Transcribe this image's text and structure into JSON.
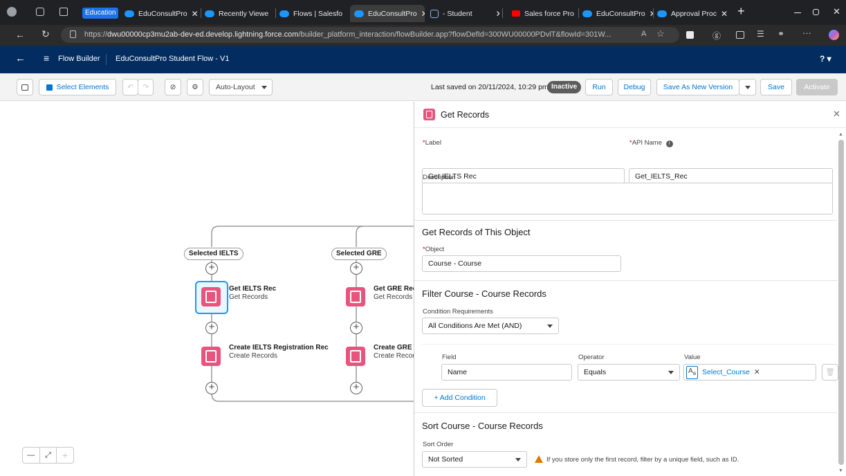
{
  "browser": {
    "tab_group_label": "Education",
    "tabs": [
      {
        "label": "EduConsultPro",
        "icon": "salesforce-icon",
        "active": false
      },
      {
        "label": "Recently Viewe",
        "icon": "salesforce-icon",
        "active": false
      },
      {
        "label": "Flows | Salesfo",
        "icon": "salesforce-icon",
        "active": false
      },
      {
        "label": "EduConsultPro",
        "icon": "salesforce-icon",
        "active": true
      },
      {
        "label": "- Student",
        "icon": "page-icon",
        "active": false
      },
      {
        "label": "Sales force Pro",
        "icon": "youtube-icon",
        "active": false
      },
      {
        "label": "EduConsultPro",
        "icon": "salesforce-icon",
        "active": false
      },
      {
        "label": "Approval Proc",
        "icon": "salesforce-icon",
        "active": false
      }
    ],
    "new_tab": "+",
    "url_prefix": "https://",
    "url_host": "dwu00000cp3mu2ab-dev-ed.develop.lightning.force.com",
    "url_path": "/builder_platform_interaction/flowBuilder.app?flowDefId=300WU00000PDvlT&flowId=301W..."
  },
  "header": {
    "app_name": "Flow Builder",
    "flow_title": "EduConsultPro Student Flow - V1",
    "help": "?"
  },
  "toolbar": {
    "select_elements": "Select Elements",
    "auto_layout": "Auto-Layout",
    "last_saved": "Last saved on 20/11/2024, 10:29 pm",
    "status_badge": "Inactive",
    "run": "Run",
    "debug": "Debug",
    "save_as_new_version": "Save As New Version",
    "save": "Save",
    "activate": "Activate"
  },
  "canvas": {
    "branches": [
      {
        "label": "Selected IELTS",
        "get_title": "Get IELTS Rec",
        "get_type": "Get Records",
        "create_title": "Create IELTS Registration Rec",
        "create_type": "Create Records"
      },
      {
        "label": "Selected GRE",
        "get_title": "Get GRE Rec",
        "get_type": "Get Records",
        "create_title": "Create GRE I",
        "create_type": "Create Recor"
      }
    ],
    "zoom_out": "—",
    "zoom_fit": "⤢",
    "zoom_in": "+"
  },
  "panel": {
    "title": "Get Records",
    "label_label": "Label",
    "label_value": "Get IELTS Rec",
    "api_name_label": "API Name",
    "api_name_value": "Get_IELTS_Rec",
    "description_label": "Description",
    "description_value": "",
    "object_section": "Get Records of This Object",
    "object_label": "Object",
    "object_value": "Course - Course",
    "filter_section": "Filter Course - Course Records",
    "condition_req_label": "Condition Requirements",
    "condition_req_value": "All Conditions Are Met (AND)",
    "col_field": "Field",
    "col_operator": "Operator",
    "col_value": "Value",
    "condition": {
      "field": "Name",
      "operator": "Equals",
      "value": "Select_Course"
    },
    "add_condition": "Add Condition",
    "sort_section": "Sort Course - Course Records",
    "sort_order_label": "Sort Order",
    "sort_order_value": "Not Sorted",
    "sort_warning": "If you store only the first record, filter by a unique field, such as ID."
  }
}
